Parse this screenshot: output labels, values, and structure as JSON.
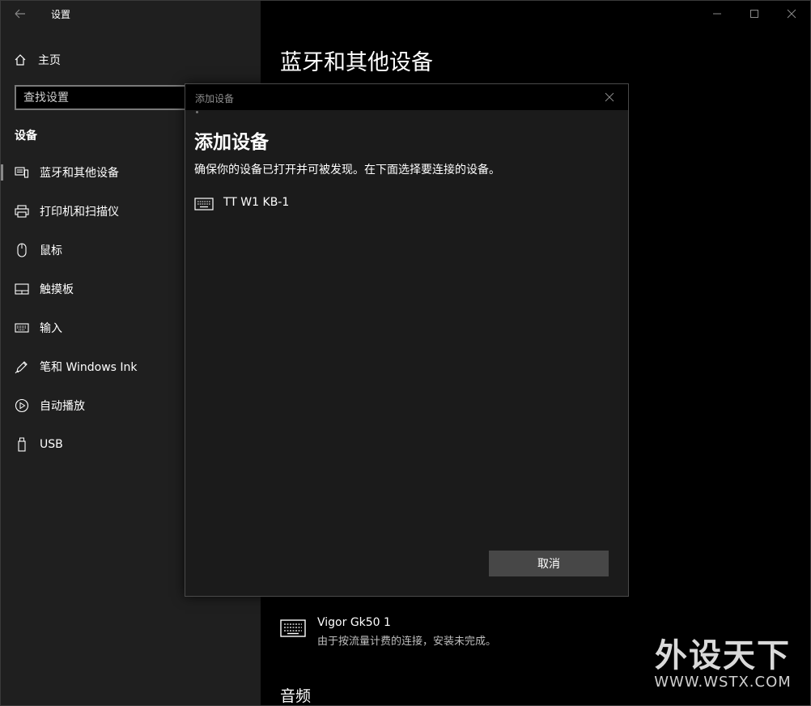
{
  "app": {
    "title": "设置"
  },
  "nav": {
    "home_label": "主页",
    "search_placeholder": "查找设置",
    "section_title": "设备",
    "items": [
      {
        "label": "蓝牙和其他设备",
        "icon": "bluetooth-devices-icon",
        "selected": true
      },
      {
        "label": "打印机和扫描仪",
        "icon": "printer-icon"
      },
      {
        "label": "鼠标",
        "icon": "mouse-icon"
      },
      {
        "label": "触摸板",
        "icon": "touchpad-icon"
      },
      {
        "label": "输入",
        "icon": "keyboard-icon"
      },
      {
        "label": "笔和 Windows Ink",
        "icon": "pen-icon"
      },
      {
        "label": "自动播放",
        "icon": "autoplay-icon"
      },
      {
        "label": "USB",
        "icon": "usb-icon"
      }
    ]
  },
  "content": {
    "page_title": "蓝牙和其他设备",
    "device": {
      "name": "Vigor Gk50 1",
      "status": "由于按流量计费的连接，安装未完成。",
      "icon": "keyboard-icon"
    },
    "sub_title": "音频"
  },
  "dialog": {
    "bar_title": "添加设备",
    "heading": "添加设备",
    "description": "确保你的设备已打开并可被发现。在下面选择要连接的设备。",
    "found_device": {
      "name": "TT W1 KB-1",
      "icon": "keyboard-icon"
    },
    "cancel_label": "取消"
  },
  "watermark": {
    "cn": "外设天下",
    "en": "WWW.WSTX.COM"
  }
}
